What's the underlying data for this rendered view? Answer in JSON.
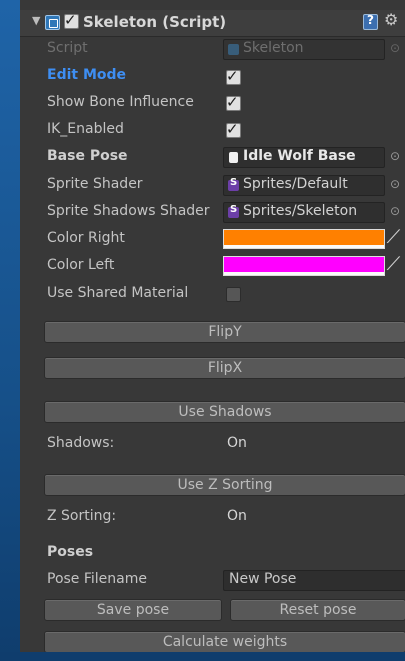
{
  "component": {
    "title": "Skeleton (Script)",
    "enabled": true
  },
  "fields": {
    "script": {
      "label": "Script",
      "value": "Skeleton"
    },
    "edit_mode": {
      "label": "Edit Mode",
      "checked": true
    },
    "show_bone_influence": {
      "label": "Show Bone Influence",
      "checked": true
    },
    "ik_enabled": {
      "label": "IK_Enabled",
      "checked": true
    },
    "base_pose": {
      "label": "Base Pose",
      "value": "Idle Wolf Base"
    },
    "sprite_shader": {
      "label": "Sprite Shader",
      "value": "Sprites/Default"
    },
    "sprite_shadows_shader": {
      "label": "Sprite Shadows Shader",
      "value": "Sprites/Skeleton"
    },
    "color_right": {
      "label": "Color Right",
      "color": "#ff8000"
    },
    "color_left": {
      "label": "Color Left",
      "color": "#ff00ff"
    },
    "use_shared_material": {
      "label": "Use Shared Material",
      "checked": false
    }
  },
  "buttons": {
    "flip_y": "FlipY",
    "flip_x": "FlipX",
    "use_shadows": "Use Shadows",
    "use_z_sorting": "Use Z Sorting",
    "save_pose": "Save pose",
    "reset_pose": "Reset pose",
    "calculate_weights": "Calculate weights"
  },
  "status": {
    "shadows": {
      "label": "Shadows:",
      "value": "On"
    },
    "z_sorting": {
      "label": "Z Sorting:",
      "value": "On"
    }
  },
  "poses": {
    "heading": "Poses",
    "filename_label": "Pose Filename",
    "filename_value": "New Pose"
  },
  "icons": [
    "foldout-arrow-icon",
    "script-icon",
    "help-icon",
    "gear-icon",
    "object-picker-icon",
    "eyedropper-icon"
  ]
}
